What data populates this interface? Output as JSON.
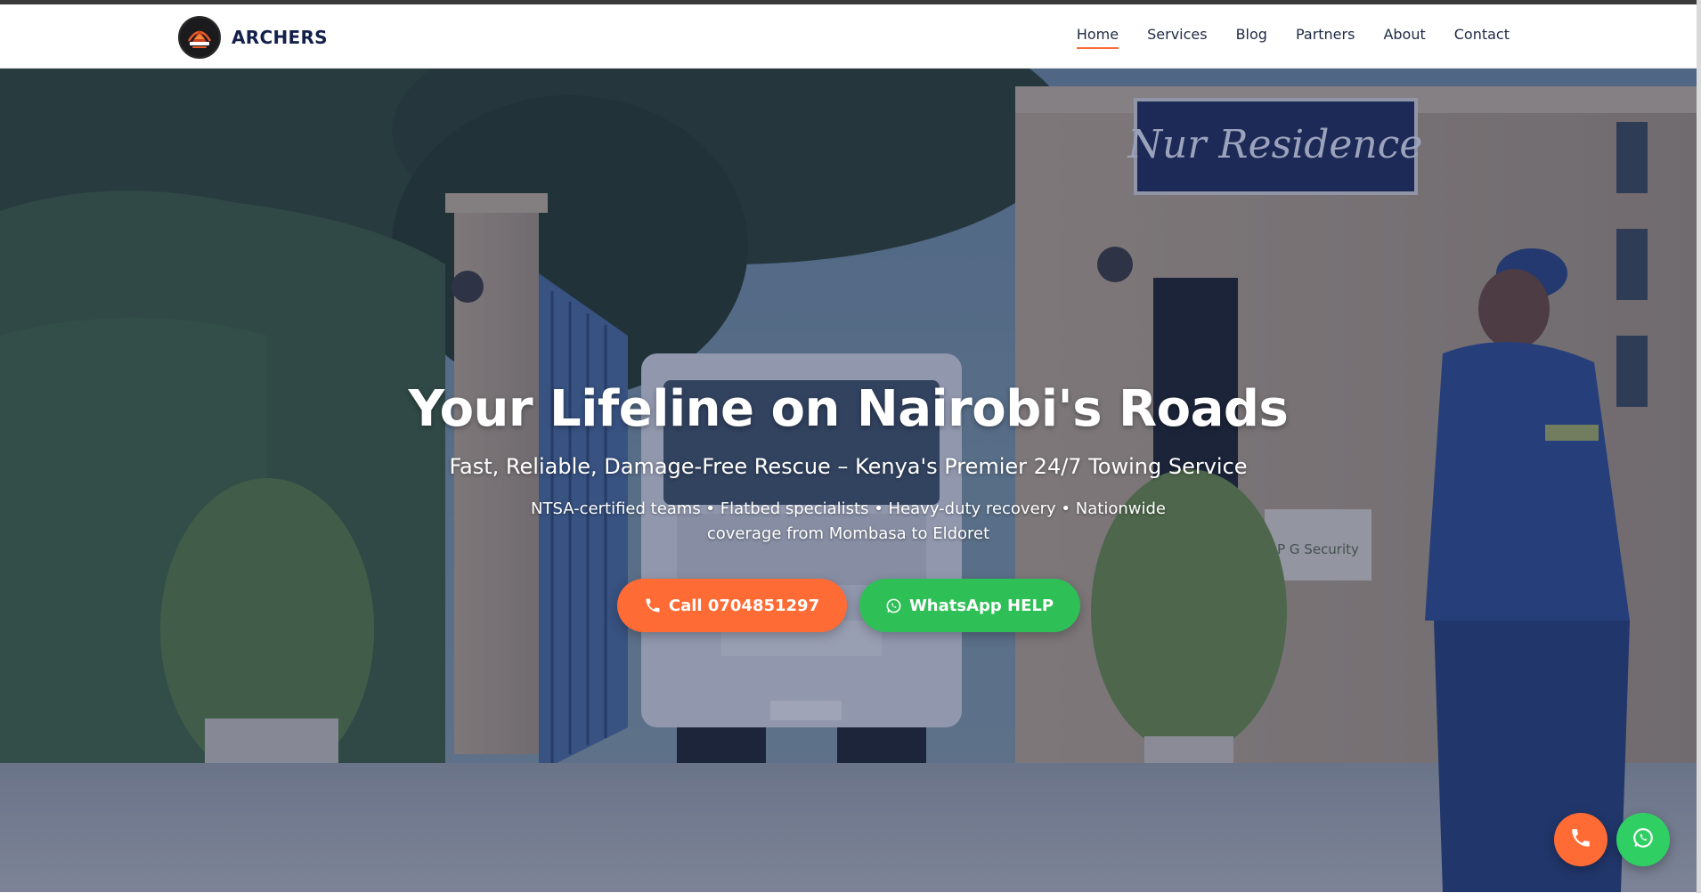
{
  "header": {
    "brand_name": "ARCHERS",
    "logo_icon": "archers-logo-icon",
    "nav": [
      {
        "label": "Home",
        "active": true
      },
      {
        "label": "Services",
        "active": false
      },
      {
        "label": "Blog",
        "active": false
      },
      {
        "label": "Partners",
        "active": false
      },
      {
        "label": "About",
        "active": false
      },
      {
        "label": "Contact",
        "active": false
      }
    ]
  },
  "hero": {
    "title": "Your Lifeline on Nairobi's Roads",
    "subtitle": "Fast, Reliable, Damage-Free Rescue – Kenya's Premier 24/7 Towing Service",
    "description": "NTSA-certified teams • Flatbed specialists • Heavy-duty recovery • Nationwide coverage from Mombasa to Eldoret",
    "call_button": "Call 0704851297",
    "whatsapp_button": "WhatsApp HELP",
    "background_sign": "Nur Residence",
    "background_sign_2": "P G Security"
  },
  "floating": {
    "call_icon": "phone-icon",
    "whatsapp_icon": "whatsapp-icon"
  },
  "colors": {
    "accent_orange": "#ff6b35",
    "whatsapp_green": "#2fbf57",
    "brand_navy": "#12204a",
    "overlay": "#1c285a"
  }
}
